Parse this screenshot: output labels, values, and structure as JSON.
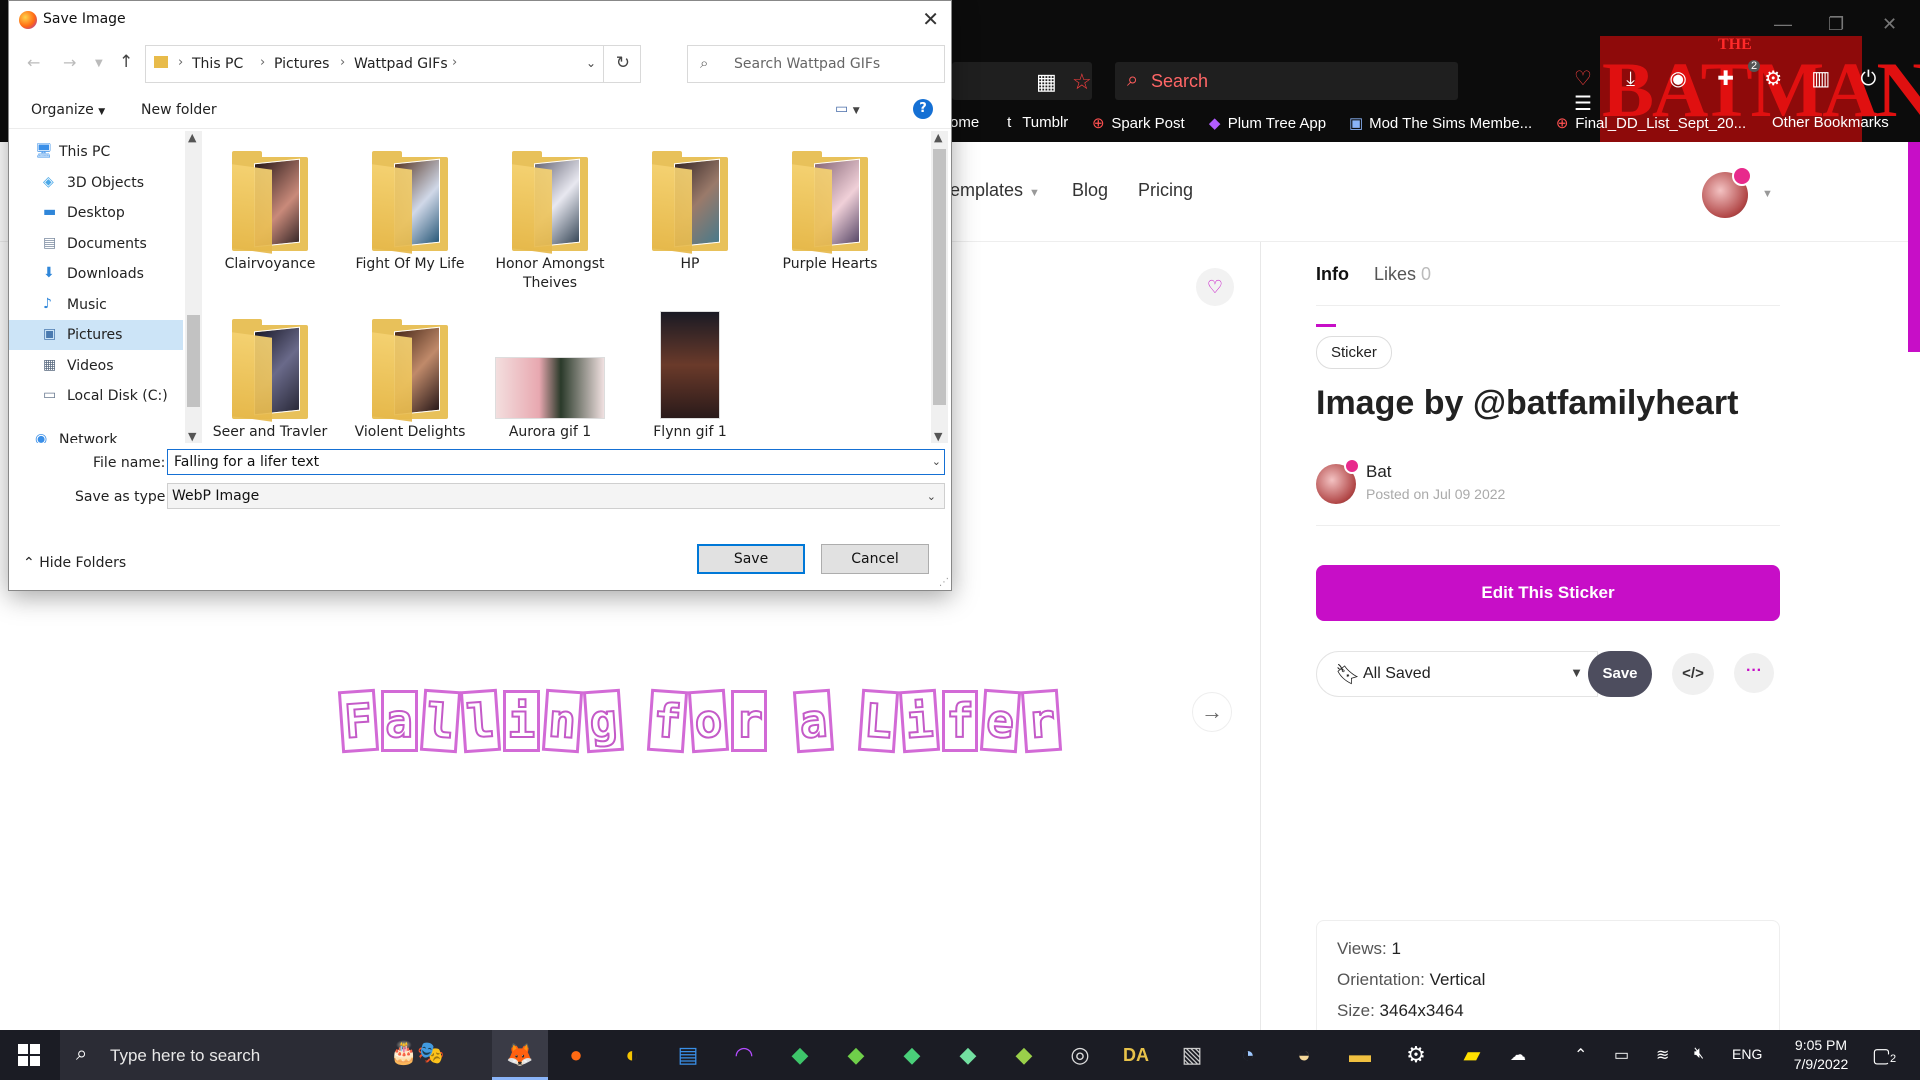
{
  "browser": {
    "search_placeholder": "Search",
    "bookmarks": [
      {
        "label": "ome",
        "icon": "home-fragment"
      },
      {
        "label": "Tumblr",
        "icon": "tumblr-icon"
      },
      {
        "label": "Spark Post",
        "icon": "globe-icon"
      },
      {
        "label": "Plum Tree App",
        "icon": "plum-tree-icon"
      },
      {
        "label": "Mod The Sims Membe...",
        "icon": "sims-icon"
      },
      {
        "label": "Final_DD_List_Sept_20...",
        "icon": "globe-icon"
      }
    ],
    "other_bookmarks": "Other Bookmarks",
    "notification_count": "2",
    "logo_top": "THE",
    "logo_word": "BATMAN"
  },
  "site": {
    "nav": [
      "emplates",
      "Blog",
      "Pricing"
    ],
    "sticker_letters": [
      "F",
      "a",
      "l",
      "l",
      "i",
      "n",
      "g",
      " ",
      "f",
      "o",
      "r",
      " ",
      "a",
      " ",
      "L",
      "i",
      "f",
      "e",
      "r"
    ],
    "tabs": {
      "info": "Info",
      "likes": "Likes",
      "likes_count": "0"
    },
    "chip": "Sticker",
    "title": "Image by @batfamilyheart",
    "author": "Bat",
    "posted": "Posted on Jul 09 2022",
    "edit_button": "Edit This Sticker",
    "saved_select": "All Saved",
    "save_button": "Save",
    "embed": "</>",
    "more": "···",
    "stats": [
      {
        "label": "Views:",
        "value": "1"
      },
      {
        "label": "Orientation:",
        "value": "Vertical"
      },
      {
        "label": "Size:",
        "value": "3464x3464"
      }
    ],
    "accent_color": "#c70ec7"
  },
  "dialog": {
    "title": "Save Image",
    "breadcrumb": [
      "This PC",
      "Pictures",
      "Wattpad GIFs"
    ],
    "search_placeholder": "Search Wattpad GIFs",
    "organize": "Organize",
    "new_folder": "New folder",
    "help": "?",
    "tree": [
      {
        "label": "This PC",
        "icon": "computer-icon"
      },
      {
        "label": "3D Objects",
        "icon": "cube-icon"
      },
      {
        "label": "Desktop",
        "icon": "desktop-icon"
      },
      {
        "label": "Documents",
        "icon": "document-icon"
      },
      {
        "label": "Downloads",
        "icon": "download-icon"
      },
      {
        "label": "Music",
        "icon": "music-icon"
      },
      {
        "label": "Pictures",
        "icon": "pictures-icon"
      },
      {
        "label": "Videos",
        "icon": "video-icon"
      },
      {
        "label": "Local Disk (C:)",
        "icon": "disk-icon"
      },
      {
        "label": "Network",
        "icon": "network-icon"
      }
    ],
    "files": [
      {
        "name": "Clairvoyance",
        "kind": "folder"
      },
      {
        "name": "Fight Of My Life",
        "kind": "folder"
      },
      {
        "name": "Honor Amongst Theives",
        "kind": "folder"
      },
      {
        "name": "HP",
        "kind": "folder"
      },
      {
        "name": "Purple Hearts",
        "kind": "folder"
      },
      {
        "name": "Seer and Travler",
        "kind": "folder"
      },
      {
        "name": "Violent Delights",
        "kind": "folder"
      },
      {
        "name": "Aurora gif 1",
        "kind": "image"
      },
      {
        "name": "Flynn gif 1",
        "kind": "image"
      }
    ],
    "file_name_label": "File name:",
    "file_name_value": "Falling for a lifer text",
    "save_type_label": "Save as type:",
    "save_type_value": "WebP Image",
    "hide_folders": "Hide Folders",
    "save": "Save",
    "cancel": "Cancel"
  },
  "taskbar": {
    "search_placeholder": "Type here to search",
    "language": "ENG",
    "time": "9:05 PM",
    "date": "7/9/2022",
    "notification_count": "2"
  }
}
